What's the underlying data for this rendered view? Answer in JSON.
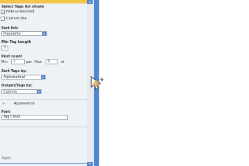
{
  "panel": {
    "header_text": "Select Tags list shows",
    "opt_hide_unselected": "Hide unselected",
    "opt_hide_unselected_checked": true,
    "opt_current_site": "Current site",
    "opt_current_site_checked": false,
    "sort_by_label": "Sort list:",
    "sort_by_value": "Popularity",
    "min_tag_length_label": "Min Tag Length",
    "min_tag_length_value": "3",
    "post_count_label": "Post count",
    "post_count_min_label": "Min",
    "post_count_min_value": "1",
    "post_count_per_label": "per",
    "post_count_max_label": "Max",
    "post_count_max_value": "5",
    "post_count_unit": "of",
    "sort_tags_label": "Sort Tags by:",
    "sort_tags_value": "Alphabetical",
    "output_label": "Output/Tags by:",
    "output_value": "Comma",
    "section_appearance": "Appearance",
    "font_label": "Font",
    "font_value": "Tag Cloud",
    "footer_text": "Apply",
    "accent_color": "#4f86d0",
    "top_bar_color": "#f3c64a"
  },
  "cursor": {
    "icon": "resize-cursor-icon"
  }
}
